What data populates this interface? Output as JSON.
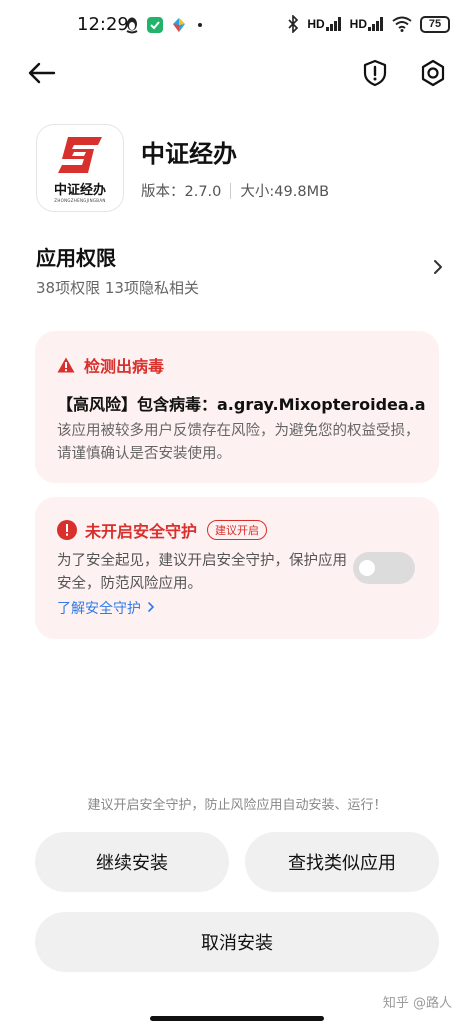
{
  "status_bar": {
    "time": "12:29",
    "signal_1": "HD",
    "signal_2": "HD",
    "battery": "75"
  },
  "app": {
    "name": "中证经办",
    "version": "版本：2.7.0",
    "size": "大小:49.8MB",
    "icon_text": "中证经办",
    "icon_subtext": "ZHONGZHENGJINGBAN",
    "brand_color": "#d8302c"
  },
  "permissions": {
    "title": "应用权限",
    "summary": "38项权限 13项隐私相关"
  },
  "virus_card": {
    "title": "检测出病毒",
    "risk_line": "【高风险】包含病毒：a.gray.Mixopteroidea.a",
    "description": "该应用被较多用户反馈存在风险，为避免您的权益受损，请谨慎确认是否安装使用。"
  },
  "guard_card": {
    "title": "未开启安全守护",
    "badge": "建议开启",
    "description": "为了安全起见，建议开启安全守护，保护应用安全，防范风险应用。",
    "link": "了解安全守护",
    "toggle_on": false
  },
  "bottom": {
    "hint": "建议开启安全守护，防止风险应用自动安装、运行！",
    "continue_label": "继续安装",
    "similar_label": "查找类似应用",
    "cancel_label": "取消安装"
  },
  "watermark": "知乎 @路人",
  "colors": {
    "danger": "#d8302c",
    "card_bg": "#fdf1f1",
    "link": "#2f7be8",
    "button_bg": "#f0f0f0"
  }
}
